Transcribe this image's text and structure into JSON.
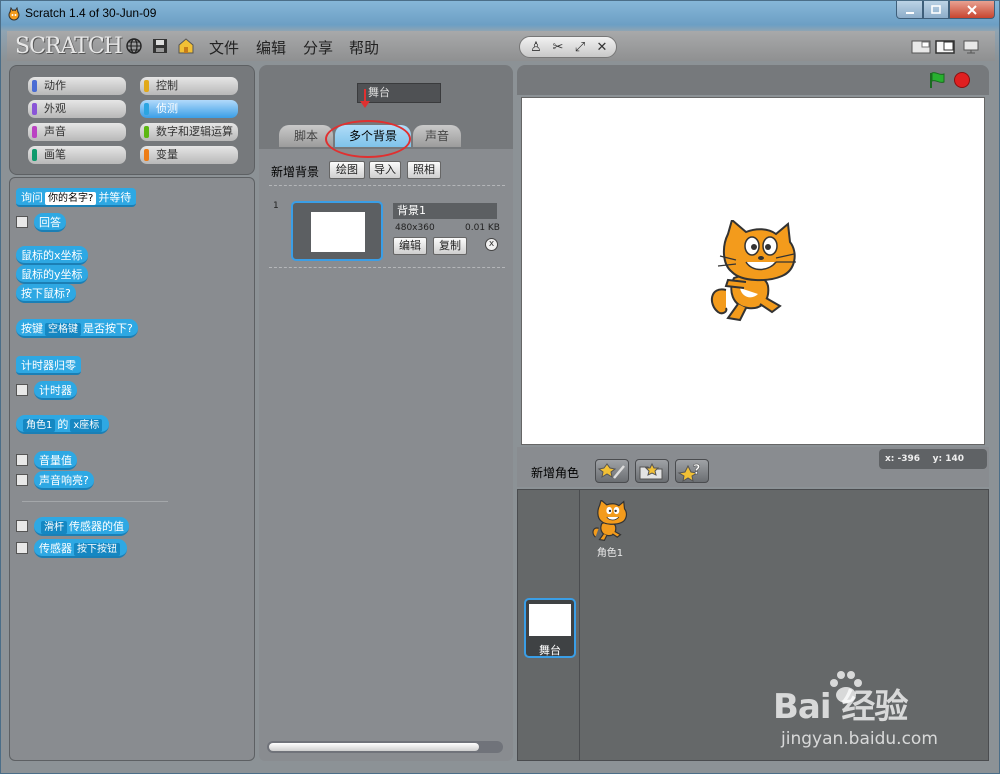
{
  "window": {
    "title": "Scratch 1.4 of 30-Jun-09"
  },
  "menu": {
    "logo": "SCRATCH",
    "items": [
      "文件",
      "编辑",
      "分享",
      "帮助"
    ]
  },
  "categories": [
    {
      "label": "动作",
      "color": "#4a6cd4"
    },
    {
      "label": "控制",
      "color": "#e1a91a"
    },
    {
      "label": "外观",
      "color": "#8a55d7"
    },
    {
      "label": "侦测",
      "color": "#2ca5e2",
      "active": true
    },
    {
      "label": "声音",
      "color": "#bb42c3"
    },
    {
      "label": "数字和逻辑运算",
      "color": "#5cb712"
    },
    {
      "label": "画笔",
      "color": "#0e9a6c"
    },
    {
      "label": "变量",
      "color": "#ee7d16"
    }
  ],
  "blocks": {
    "ask_prefix": "询问",
    "ask_slot": "你的名字?",
    "ask_suffix": "并等待",
    "answer": "回答",
    "mouse_x": "鼠标的x坐标",
    "mouse_y": "鼠标的y坐标",
    "mouse_down": "按下鼠标?",
    "key_prefix": "按键",
    "key_drop": "空格键",
    "key_suffix": "是否按下?",
    "timer_reset": "计时器归零",
    "timer": "计时器",
    "of_sprite": "角色1",
    "of_word": "的",
    "of_attr": "x座标",
    "loudness": "音量值",
    "loud": "声音响亮?",
    "sensor_drop": "滑杆",
    "sensor_suffix": "传感器的值",
    "sensor_prefix": "传感器",
    "sensor_btn": "按下按钮"
  },
  "middle": {
    "name_field": "舞台",
    "tabs": [
      "脚本",
      "多个背景",
      "声音"
    ],
    "new_backdrop_label": "新增背景",
    "buttons": [
      "绘图",
      "导入",
      "照相"
    ],
    "costume": {
      "number": "1",
      "name": "背景1",
      "size": "480x360",
      "kb": "0.01 KB",
      "edit": "编辑",
      "copy": "复制",
      "delete": "x"
    }
  },
  "stage_info": {
    "coords_x_label": "x:",
    "coords_x": "-396",
    "coords_y_label": "y:",
    "coords_y": "140",
    "new_sprite_label": "新增角色"
  },
  "sprites": {
    "stage_label": "舞台",
    "sprite_name": "角色1"
  },
  "watermark": {
    "main": "Bai 经验",
    "sub": "jingyan.baidu.com"
  },
  "colors": {
    "accent_blue": "#3a9ee6",
    "sensing_block": "#2ea8e3",
    "annotation_red": "#e03030",
    "green_flag": "#28b030",
    "stop": "#e02020"
  }
}
